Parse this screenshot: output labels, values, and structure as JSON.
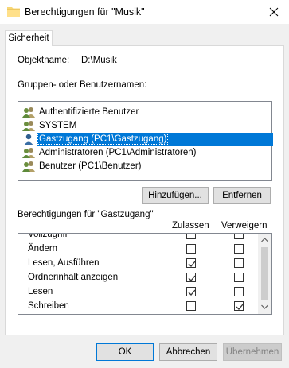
{
  "window": {
    "title": "Berechtigungen für \"Musik\"",
    "close_label": "✕"
  },
  "tabs": [
    {
      "label": "Sicherheit",
      "active": true
    }
  ],
  "object": {
    "label": "Objektname:",
    "value": "D:\\Musik"
  },
  "groups": {
    "label": "Gruppen- oder Benutzernamen:",
    "items": [
      {
        "name": "Authentifizierte Benutzer",
        "icon": "group-icon",
        "selected": false
      },
      {
        "name": "SYSTEM",
        "icon": "group-icon",
        "selected": false
      },
      {
        "name": "Gastzugang (PC1\\Gastzugang)",
        "icon": "user-icon",
        "selected": true
      },
      {
        "name": "Administratoren (PC1\\Administratoren)",
        "icon": "group-icon",
        "selected": false
      },
      {
        "name": "Benutzer (PC1\\Benutzer)",
        "icon": "group-icon",
        "selected": false
      }
    ],
    "add_button": "Hinzufügen...",
    "remove_button": "Entfernen"
  },
  "permissions": {
    "label": "Berechtigungen für \"Gastzugang\"",
    "col_allow": "Zulassen",
    "col_deny": "Verweigern",
    "rows": [
      {
        "name": "Vollzugriff",
        "allow": false,
        "deny": false
      },
      {
        "name": "Ändern",
        "allow": false,
        "deny": false
      },
      {
        "name": "Lesen, Ausführen",
        "allow": true,
        "deny": false
      },
      {
        "name": "Ordnerinhalt anzeigen",
        "allow": true,
        "deny": false
      },
      {
        "name": "Lesen",
        "allow": true,
        "deny": false
      },
      {
        "name": "Schreiben",
        "allow": false,
        "deny": true
      }
    ]
  },
  "footer": {
    "ok": "OK",
    "cancel": "Abbrechen",
    "apply": "Übernehmen"
  },
  "colors": {
    "selection": "#0078d7",
    "dialog_bg": "#f0f0f0"
  }
}
